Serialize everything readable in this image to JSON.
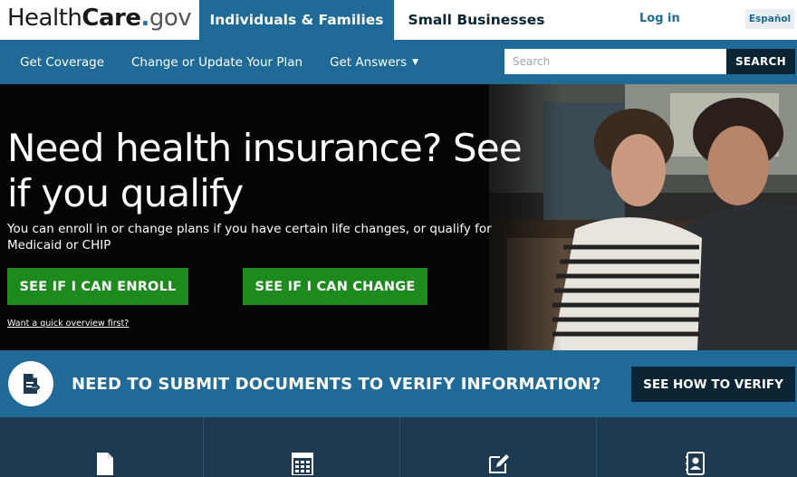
{
  "header": {
    "logo": {
      "health": "Health",
      "care": "Care",
      "dot": ".",
      "gov": "gov"
    },
    "tabs": [
      {
        "label": "Individuals & Families",
        "active": true
      },
      {
        "label": "Small Businesses",
        "active": false
      }
    ],
    "login_label": "Log in",
    "language_label": "Español"
  },
  "nav": {
    "items": [
      {
        "label": "Get Coverage"
      },
      {
        "label": "Change or Update Your Plan"
      },
      {
        "label": "Get Answers",
        "has_dropdown": true
      }
    ],
    "search": {
      "placeholder": "Search",
      "value": "",
      "button_label": "SEARCH"
    }
  },
  "hero": {
    "title": "Need health insurance? See if you qualify",
    "subtitle": "You can enroll in or change plans if you have certain life changes, or qualify for Medicaid or CHIP",
    "buttons": [
      {
        "label": "SEE IF I CAN ENROLL"
      },
      {
        "label": "SEE IF I CAN CHANGE"
      }
    ],
    "overview_link": "Want a quick overview first?"
  },
  "verify_banner": {
    "icon": "document-arrow-icon",
    "text": "NEED TO SUBMIT DOCUMENTS TO VERIFY INFORMATION?",
    "button_label": "SEE HOW TO VERIFY"
  },
  "bottom_icons": [
    "document-icon",
    "calendar-icon",
    "edit-icon",
    "contact-book-icon"
  ],
  "colors": {
    "primary_blue": "#1f6a96",
    "dark_navy": "#0b2535",
    "button_green": "#1c8a1c",
    "bottom_band": "#1d3a50"
  }
}
